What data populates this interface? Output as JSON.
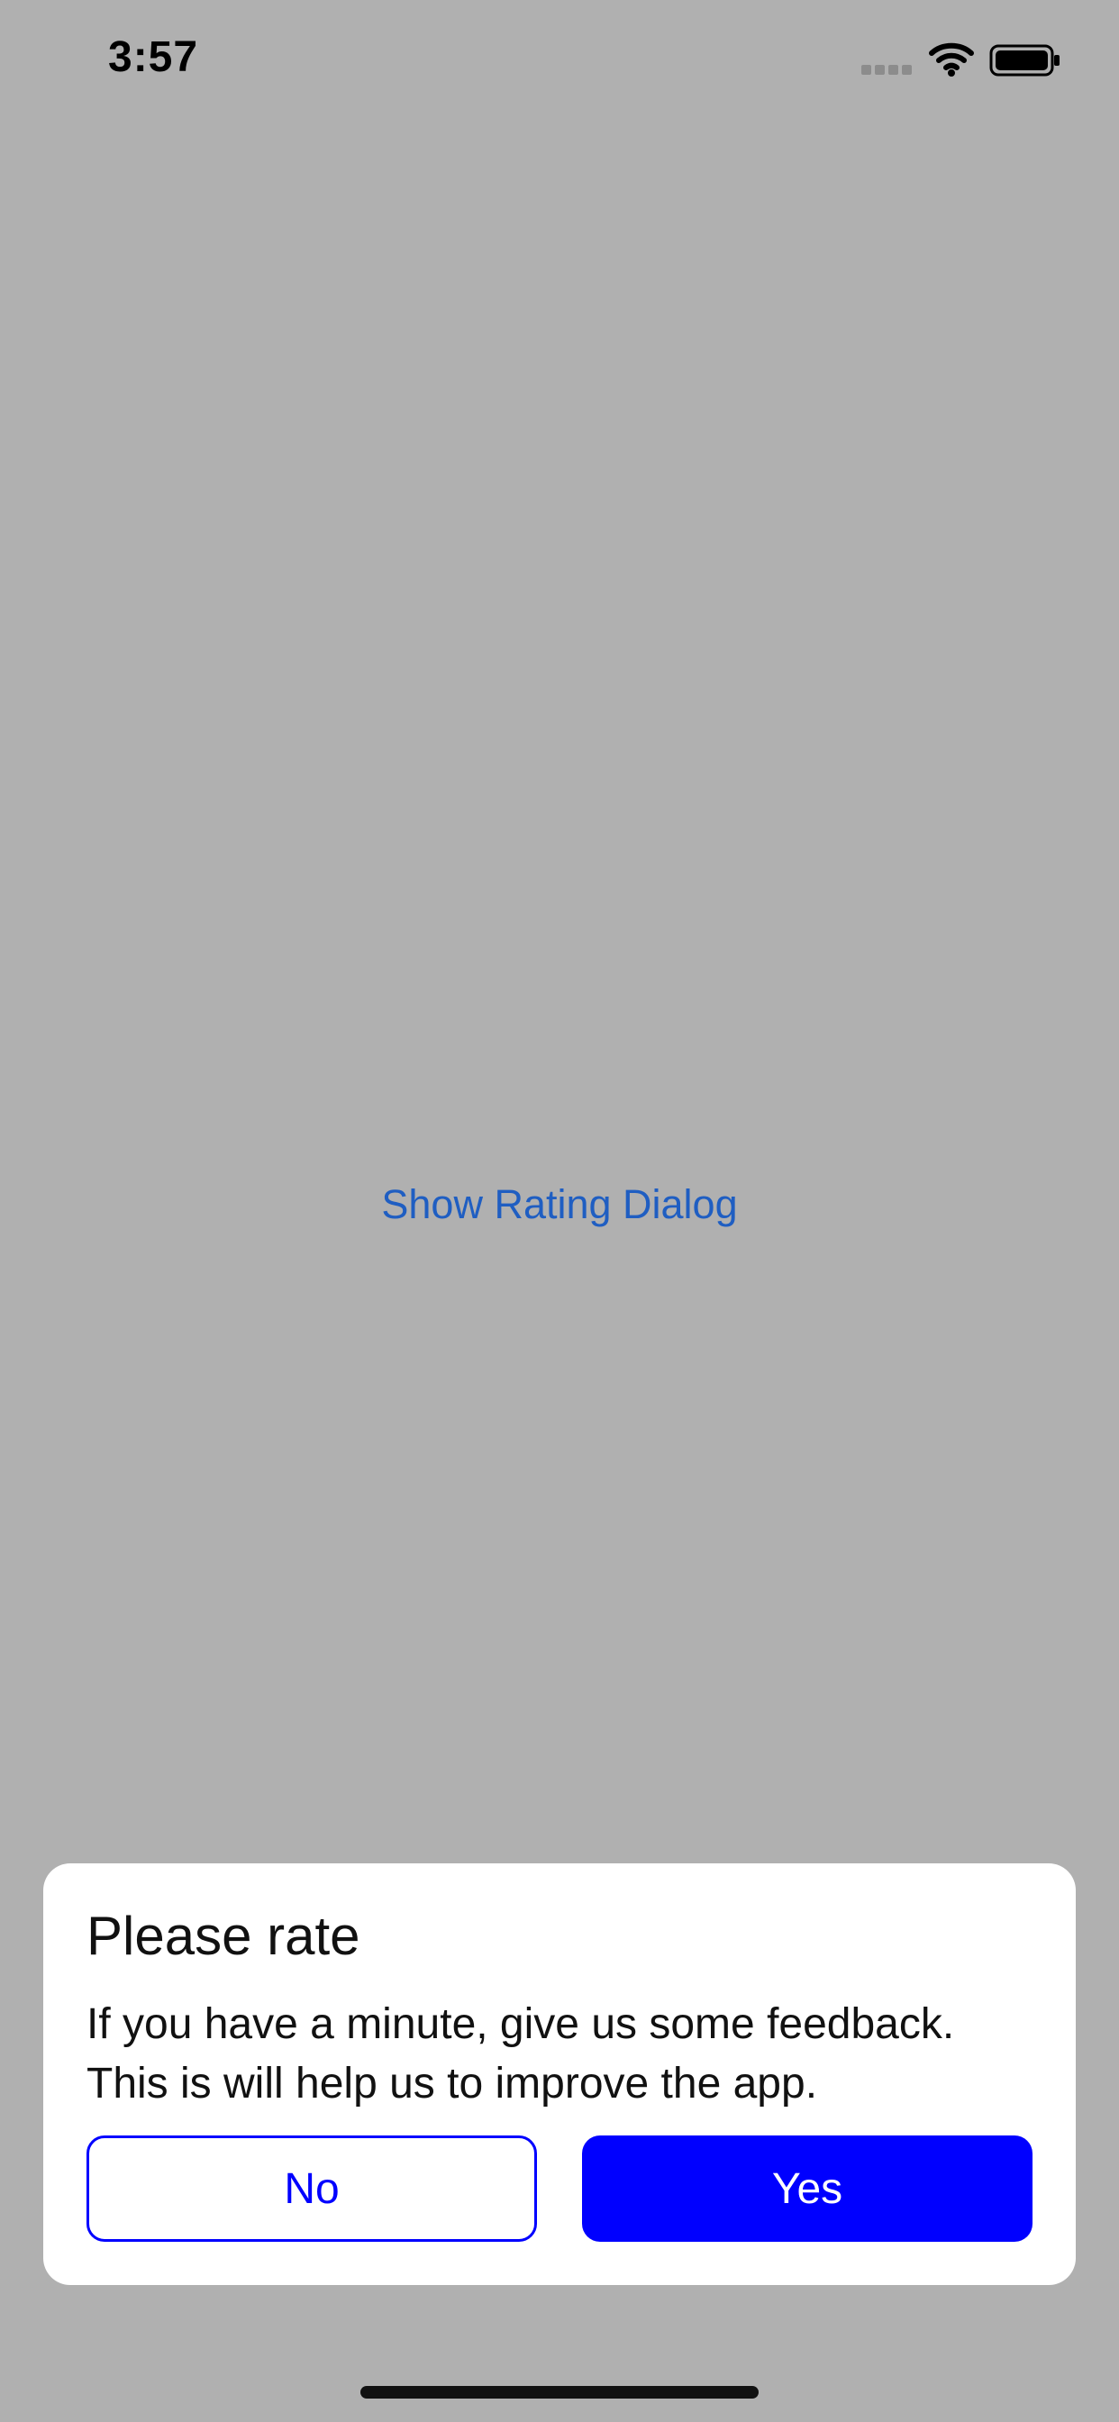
{
  "status_bar": {
    "time": "3:57",
    "icons": {
      "signal": "signal-icon",
      "wifi": "wifi-icon",
      "battery": "battery-icon"
    }
  },
  "main": {
    "link_label": "Show Rating Dialog"
  },
  "dialog": {
    "title": "Please rate",
    "body_lines": [
      "If you have a minute, give us some feedback.",
      "This is will help us to improve the app."
    ],
    "buttons": {
      "no_label": "No",
      "yes_label": "Yes"
    }
  },
  "colors": {
    "background": "#b0b0b0",
    "link": "#1f5ec2",
    "accent": "#0000ff",
    "dialog_background": "#ffffff",
    "text": "#111111"
  }
}
